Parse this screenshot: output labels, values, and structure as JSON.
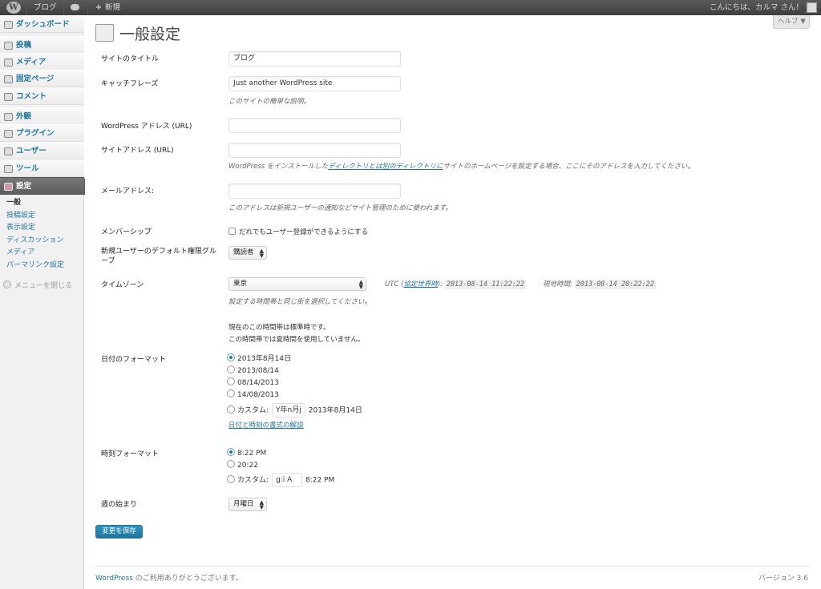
{
  "adminbar": {
    "wp_logo": "wordpress-logo-icon",
    "site_name": "ブログ",
    "new_label": "新規",
    "greeting": "こんにちは、カルマ さん！"
  },
  "sidebar": {
    "items": [
      {
        "label": "ダッシュボード",
        "icon": "dashboard-icon"
      },
      {
        "label": "投稿",
        "icon": "pin-icon"
      },
      {
        "label": "メディア",
        "icon": "media-icon"
      },
      {
        "label": "固定ページ",
        "icon": "page-icon"
      },
      {
        "label": "コメント",
        "icon": "comment-icon"
      },
      {
        "label": "外観",
        "icon": "appearance-icon"
      },
      {
        "label": "プラグイン",
        "icon": "plugin-icon"
      },
      {
        "label": "ユーザー",
        "icon": "users-icon"
      },
      {
        "label": "ツール",
        "icon": "tools-icon"
      },
      {
        "label": "設定",
        "icon": "settings-icon"
      }
    ],
    "submenu": [
      "一般",
      "投稿設定",
      "表示設定",
      "ディスカッション",
      "メディア",
      "パーマリンク設定"
    ],
    "collapse_label": "メニューを閉じる"
  },
  "header": {
    "help_label": "ヘルプ ▼",
    "title": "一般設定"
  },
  "form": {
    "site_title": {
      "label": "サイトのタイトル",
      "value": "ブログ"
    },
    "tagline": {
      "label": "キャッチフレーズ",
      "value": "Just another WordPress site",
      "desc": "このサイトの簡単な説明。"
    },
    "wp_address": {
      "label": "WordPress アドレス (URL)"
    },
    "site_address": {
      "label": "サイトアドレス (URL)",
      "desc_pre": "WordPress をインストールした",
      "desc_link": "ディレクトリとは別のディレクトリに",
      "desc_post": "サイトのホームページを設定する場合、ここにそのアドレスを入力してください。"
    },
    "email": {
      "label": "メールアドレス:",
      "desc": "このアドレスは新規ユーザーの通知などサイト管理のために使われます。"
    },
    "membership": {
      "label": "メンバーシップ",
      "checkbox_label": "だれでもユーザー登録ができるようにする"
    },
    "default_role": {
      "label": "新規ユーザーのデフォルト権限グループ",
      "value": "購読者"
    },
    "timezone": {
      "label": "タイムゾーン",
      "value": "東京",
      "utc_label": "UTC (",
      "utc_link": "協定世界時",
      "utc_close": "):",
      "utc_time": "2013-08-14 11:22:22",
      "local_label": "現地時間:",
      "local_time": "2013-08-14 20:22:22",
      "desc": "設定する時間帯と同じ街を選択してください。",
      "note1": "現在のこの時間帯は標準時です。",
      "note2": "この時間帯では夏時間を使用していません。"
    },
    "date_format": {
      "label": "日付のフォーマット",
      "options": [
        "2013年8月14日",
        "2013/08/14",
        "08/14/2013",
        "14/08/2013"
      ],
      "selected": 0,
      "custom_label": "カスタム:",
      "custom_value": "Y年n月j",
      "custom_preview": "2013年8月14日",
      "doc_link": "日付と時刻の書式の解説"
    },
    "time_format": {
      "label": "時刻フォーマット",
      "options": [
        "8:22 PM",
        "20:22"
      ],
      "selected": 0,
      "custom_label": "カスタム:",
      "custom_value": "g:i A",
      "custom_preview": "8:22 PM"
    },
    "start_of_week": {
      "label": "週の始まり",
      "value": "月曜日"
    },
    "save_label": "変更を保存"
  },
  "footer": {
    "link": "WordPress",
    "thanks": " のご利用ありがとうございます。",
    "version": "バージョン 3.6"
  }
}
